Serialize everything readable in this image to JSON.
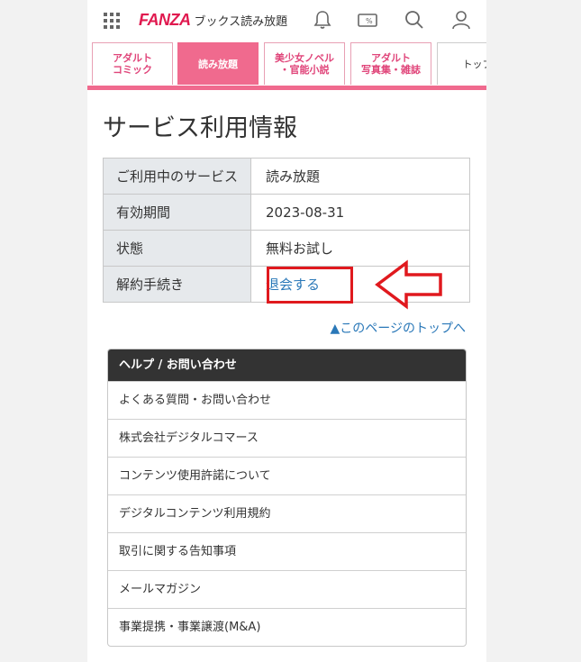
{
  "header": {
    "logo": "FANZA",
    "service": "ブックス読み放題",
    "icons": [
      "grid-icon",
      "bell-icon",
      "coupon-icon",
      "search-icon",
      "user-icon"
    ],
    "coupon_glyph": "%"
  },
  "tabs": [
    {
      "label": "アダルト\nコミック",
      "active": false
    },
    {
      "label": "読み放題",
      "active": true
    },
    {
      "label": "美少女ノベル\n・官能小説",
      "active": false
    },
    {
      "label": "アダルト\n写真集・雑誌",
      "active": false
    },
    {
      "label": "トップ",
      "active": false
    }
  ],
  "main": {
    "title": "サービス利用情報",
    "rows": [
      {
        "label": "ご利用中のサービス",
        "value": "読み放題"
      },
      {
        "label": "有効期間",
        "value": "2023-08-31"
      },
      {
        "label": "状態",
        "value": "無料お試し"
      },
      {
        "label": "解約手続き",
        "value": "退会する"
      }
    ],
    "page_top_link": "▲このページのトップへ"
  },
  "help": {
    "title": "ヘルプ / お問い合わせ",
    "items": [
      "よくある質問・お問い合わせ",
      "株式会社デジタルコマース",
      "コンテンツ使用許諾について",
      "デジタルコンテンツ利用規約",
      "取引に関する告知事項",
      "メールマガジン",
      "事業提携・事業譲渡(M&A)"
    ]
  },
  "colors": {
    "brand": "#e0194f",
    "tab_active": "#f06a8e",
    "link": "#2a78b8",
    "annotation": "#e0191e"
  }
}
